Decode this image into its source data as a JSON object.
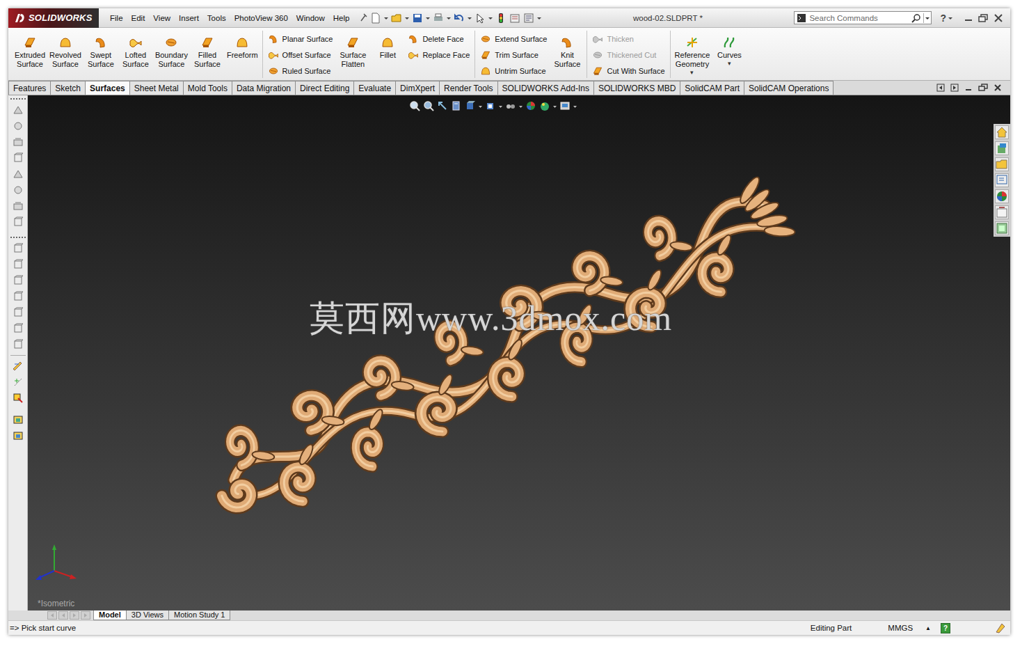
{
  "app": {
    "logo": "SOLIDWORKS"
  },
  "menu": [
    "File",
    "Edit",
    "View",
    "Insert",
    "Tools",
    "PhotoView 360",
    "Window",
    "Help"
  ],
  "window": {
    "title": "wood-02.SLDPRT *"
  },
  "search": {
    "placeholder": "Search Commands"
  },
  "help": {
    "label": "?"
  },
  "ribbon": [
    {
      "kind": "large",
      "label": "Extruded\nSurface",
      "disabled": false
    },
    {
      "kind": "large",
      "label": "Revolved\nSurface",
      "disabled": false
    },
    {
      "kind": "large",
      "label": "Swept\nSurface",
      "disabled": false
    },
    {
      "kind": "large",
      "label": "Lofted\nSurface",
      "disabled": false
    },
    {
      "kind": "large",
      "label": "Boundary\nSurface",
      "disabled": false
    },
    {
      "kind": "large",
      "label": "Filled\nSurface",
      "disabled": false
    },
    {
      "kind": "large",
      "label": "Freeform",
      "disabled": false
    },
    {
      "kind": "separator"
    },
    {
      "kind": "stack",
      "items": [
        {
          "label": "Planar Surface",
          "disabled": false
        },
        {
          "label": "Offset Surface",
          "disabled": false
        },
        {
          "label": "Ruled Surface",
          "disabled": false
        }
      ]
    },
    {
      "kind": "large",
      "label": "Surface\nFlatten",
      "disabled": false
    },
    {
      "kind": "large",
      "label": "Fillet",
      "disabled": false
    },
    {
      "kind": "stack",
      "items": [
        {
          "label": "Delete Face",
          "disabled": false
        },
        {
          "label": "Replace Face",
          "disabled": false
        }
      ]
    },
    {
      "kind": "separator"
    },
    {
      "kind": "stack",
      "items": [
        {
          "label": "Extend Surface",
          "disabled": false
        },
        {
          "label": "Trim Surface",
          "disabled": false
        },
        {
          "label": "Untrim Surface",
          "disabled": false
        }
      ]
    },
    {
      "kind": "large",
      "label": "Knit\nSurface",
      "disabled": false
    },
    {
      "kind": "separator"
    },
    {
      "kind": "stack",
      "items": [
        {
          "label": "Thicken",
          "disabled": true
        },
        {
          "label": "Thickened Cut",
          "disabled": true
        },
        {
          "label": "Cut With Surface",
          "disabled": false
        }
      ]
    },
    {
      "kind": "separator"
    },
    {
      "kind": "large",
      "label": "Reference\nGeometry",
      "disabled": false,
      "arrow": "▾"
    },
    {
      "kind": "large",
      "label": "Curves",
      "disabled": false,
      "arrow": "▾"
    }
  ],
  "tabs": [
    {
      "label": "Features",
      "selected": false
    },
    {
      "label": "Sketch",
      "selected": false
    },
    {
      "label": "Surfaces",
      "selected": true
    },
    {
      "label": "Sheet Metal",
      "selected": false
    },
    {
      "label": "Mold Tools",
      "selected": false
    },
    {
      "label": "Data Migration",
      "selected": false
    },
    {
      "label": "Direct Editing",
      "selected": false
    },
    {
      "label": "Evaluate",
      "selected": false
    },
    {
      "label": "DimXpert",
      "selected": false
    },
    {
      "label": "Render Tools",
      "selected": false
    },
    {
      "label": "SOLIDWORKS Add-Ins",
      "selected": false
    },
    {
      "label": "SOLIDWORKS MBD",
      "selected": false
    },
    {
      "label": "SolidCAM Part",
      "selected": false
    },
    {
      "label": "SolidCAM Operations",
      "selected": false
    }
  ],
  "viewport": {
    "view": "*Isometric",
    "watermark": "莫西网www.3dmox.com"
  },
  "bottom_tabs": [
    {
      "label": "Model",
      "selected": true
    },
    {
      "label": "3D Views",
      "selected": false
    },
    {
      "label": "Motion Study 1",
      "selected": false
    }
  ],
  "status_bar": {
    "prompt": "=> Pick start curve",
    "mode": "Editing Part",
    "units": "MMGS",
    "units_arrow": "▲",
    "help": "?"
  }
}
